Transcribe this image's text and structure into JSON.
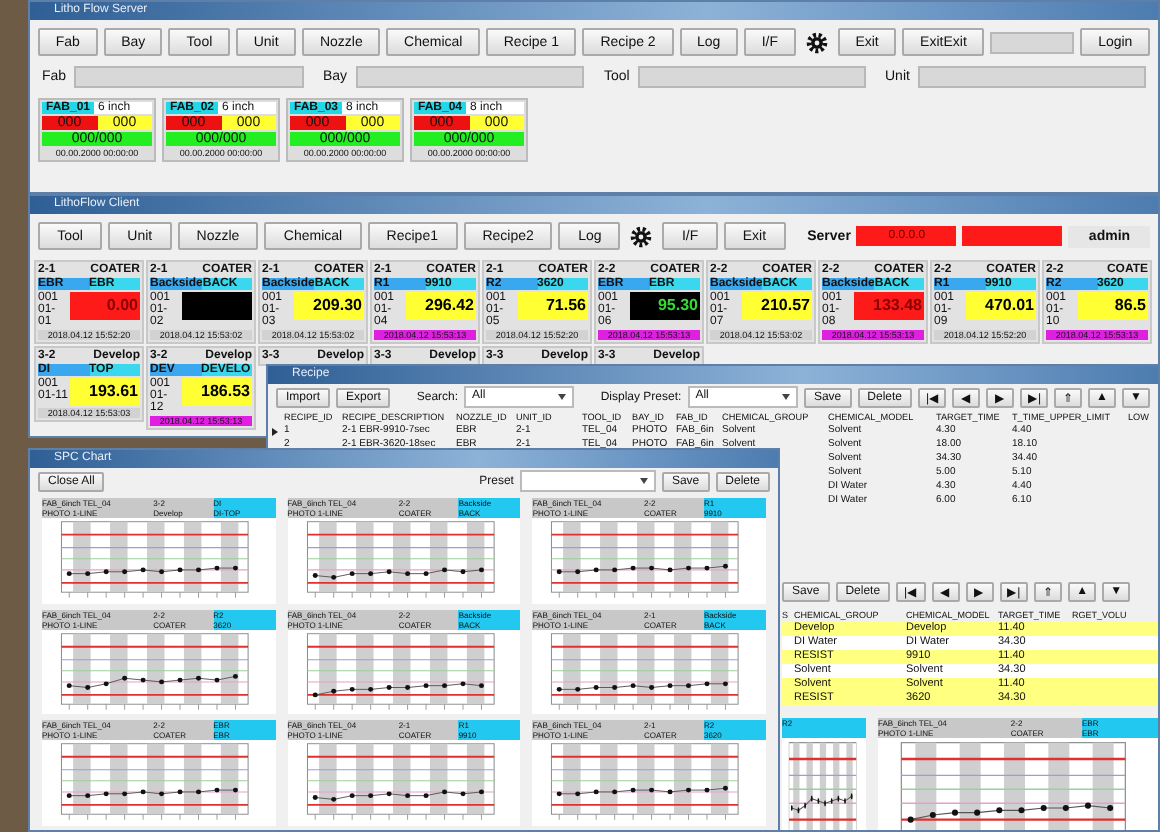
{
  "server_window": {
    "title": "Litho Flow Server",
    "toolbar": [
      {
        "kind": "button",
        "label": "Fab"
      },
      {
        "kind": "button",
        "label": "Bay"
      },
      {
        "kind": "button",
        "label": "Tool"
      },
      {
        "kind": "button",
        "label": "Unit"
      },
      {
        "kind": "button",
        "label": "Nozzle"
      },
      {
        "kind": "button",
        "label": "Chemical"
      },
      {
        "kind": "button",
        "label": "Recipe 1"
      },
      {
        "kind": "button",
        "label": "Recipe 2"
      },
      {
        "kind": "button",
        "label": "Log"
      },
      {
        "kind": "button",
        "label": "I/F"
      },
      {
        "kind": "gear"
      },
      {
        "kind": "button",
        "label": "Exit"
      },
      {
        "kind": "button",
        "label": "ExitExit"
      },
      {
        "kind": "field"
      },
      {
        "kind": "button",
        "label": "Login"
      }
    ],
    "filters": [
      {
        "label": "Fab"
      },
      {
        "label": "Bay"
      },
      {
        "label": "Tool"
      },
      {
        "label": "Unit"
      }
    ],
    "fabs": [
      {
        "name": "FAB_01",
        "size": "6 inch",
        "alarm": "000",
        "warning": "000",
        "count": "000/000",
        "time": "00.00.2000 00:00:00"
      },
      {
        "name": "FAB_02",
        "size": "6 inch",
        "alarm": "000",
        "warning": "000",
        "count": "000/000",
        "time": "00.00.2000 00:00:00"
      },
      {
        "name": "FAB_03",
        "size": "8 inch",
        "alarm": "000",
        "warning": "000",
        "count": "000/000",
        "time": "00.00.2000 00:00:00"
      },
      {
        "name": "FAB_04",
        "size": "8 inch",
        "alarm": "000",
        "warning": "000",
        "count": "000/000",
        "time": "00.00.2000 00:00:00"
      }
    ]
  },
  "client_window": {
    "title": "LithoFlow Client",
    "toolbar": [
      {
        "kind": "button",
        "label": "Tool"
      },
      {
        "kind": "button",
        "label": "Unit"
      },
      {
        "kind": "button",
        "label": "Nozzle"
      },
      {
        "kind": "button",
        "label": "Chemical"
      },
      {
        "kind": "button",
        "label": "Recipe1"
      },
      {
        "kind": "button",
        "label": "Recipe2"
      },
      {
        "kind": "button",
        "label": "Log"
      },
      {
        "kind": "gear"
      },
      {
        "kind": "button",
        "label": "I/F"
      },
      {
        "kind": "button",
        "label": "Exit"
      },
      {
        "kind": "label",
        "label": "Server"
      },
      {
        "kind": "status",
        "value": "0.0.0.0",
        "color": "#ff1a1a"
      },
      {
        "kind": "status",
        "color": "#ff1a1a"
      },
      {
        "kind": "user",
        "label": "admin"
      }
    ],
    "units": [
      {
        "unit": "2-1",
        "type": "COATER",
        "nozzle": "EBR",
        "chemical": "EBR",
        "id": "001",
        "slot": "01-01",
        "value": "0.00",
        "color": "#ff1a1a",
        "time": "2018.04.12 15:52:20",
        "highlight": false
      },
      {
        "unit": "2-1",
        "type": "COATER",
        "nozzle": "Backside",
        "chemical": "BACK",
        "id": "001",
        "slot": "01-02",
        "color": "#000000",
        "time": "2018.04.12 15:53:02",
        "highlight": false
      },
      {
        "unit": "2-1",
        "type": "COATER",
        "nozzle": "Backside",
        "chemical": "BACK",
        "id": "001",
        "slot": "01-03",
        "value": "209.30",
        "color": "#ffff33",
        "time": "2018.04.12 15:53:02",
        "highlight": false
      },
      {
        "unit": "2-1",
        "type": "COATER",
        "nozzle": "R1",
        "chemical": "9910",
        "id": "001",
        "slot": "01-04",
        "value": "296.42",
        "color": "#ffff33",
        "time": "2018.04.12 15:53:13",
        "highlight": true
      },
      {
        "unit": "2-1",
        "type": "COATER",
        "nozzle": "R2",
        "chemical": "3620",
        "id": "001",
        "slot": "01-05",
        "value": "71.56",
        "color": "#ffff33",
        "time": "2018.04.12 15:52:20",
        "highlight": false
      },
      {
        "unit": "2-2",
        "type": "COATER",
        "nozzle": "EBR",
        "chemical": "EBR",
        "id": "001",
        "slot": "01-06",
        "value": "95.30",
        "color": "#000000",
        "time": "2018.04.12 15:53:13",
        "highlight": true
      },
      {
        "unit": "2-2",
        "type": "COATER",
        "nozzle": "Backside",
        "chemical": "BACK",
        "id": "001",
        "slot": "01-07",
        "value": "210.57",
        "color": "#ffff33",
        "time": "2018.04.12 15:53:02",
        "highlight": false
      },
      {
        "unit": "2-2",
        "type": "COATER",
        "nozzle": "Backside",
        "chemical": "BACK",
        "id": "001",
        "slot": "01-08",
        "value": "133.48",
        "color": "#ff1a1a",
        "time": "2018.04.12 15:53:13",
        "highlight": true
      },
      {
        "unit": "2-2",
        "type": "COATER",
        "nozzle": "R1",
        "chemical": "9910",
        "id": "001",
        "slot": "01-09",
        "value": "470.01",
        "color": "#ffff33",
        "time": "2018.04.12 15:52:20",
        "highlight": false
      },
      {
        "unit": "2-2",
        "type": "COATE",
        "nozzle": "R2",
        "chemical": "3620",
        "id": "001",
        "slot": "01-10",
        "value": "86.5",
        "color": "#ffff33",
        "time": "2018.04.12 15:53:13",
        "highlight": true
      },
      {
        "unit": "3-2",
        "type": "Develop",
        "nozzle": "DI",
        "chemical": "TOP",
        "id": "001",
        "slot": "01-11",
        "value": "193.61",
        "color": "#ffff33",
        "time": "2018.04.12 15:53:03",
        "highlight": false
      },
      {
        "unit": "3-2",
        "type": "Develop",
        "nozzle": "DEV",
        "chemical": "DEVELO",
        "id": "001",
        "slot": "01-12",
        "value": "186.53",
        "color": "#ffff33",
        "time": "2018.04.12 15:53:13",
        "highlight": true
      },
      {
        "unit": "3-3",
        "type": "Develop"
      },
      {
        "unit": "3-3",
        "type": "Develop"
      },
      {
        "unit": "3-3",
        "type": "Develop"
      },
      {
        "unit": "3-3",
        "type": "Develop"
      }
    ]
  },
  "recipe_window": {
    "title": "Recipe",
    "toolbar": [
      {
        "kind": "button",
        "label": "Import"
      },
      {
        "kind": "button",
        "label": "Export"
      },
      {
        "kind": "select",
        "label": "Search:",
        "value": "All"
      },
      {
        "kind": "select",
        "label": "Display Preset:",
        "value": "All"
      },
      {
        "kind": "button",
        "label": "Save"
      },
      {
        "kind": "button",
        "label": "Delete"
      },
      {
        "kind": "nav",
        "label": "|◀"
      },
      {
        "kind": "nav",
        "label": "◀"
      },
      {
        "kind": "nav",
        "label": "▶"
      },
      {
        "kind": "nav",
        "label": "▶|"
      },
      {
        "kind": "nav",
        "label": "⇑"
      },
      {
        "kind": "nav",
        "label": "▲"
      },
      {
        "kind": "nav",
        "label": "▼"
      }
    ],
    "table": {
      "columns": [
        "RECIPE_ID",
        "RECIPE_DESCRIPTION",
        "NOZZLE_ID",
        "UNIT_ID",
        "TOOL_ID",
        "BAY_ID",
        "FAB_ID",
        "CHEMICAL_GROUP",
        "CHEMICAL_MODEL",
        "TARGET_TIME",
        "T_TIME_UPPER_LIMIT",
        "LOW"
      ],
      "rows": [
        {
          "selected": true,
          "cells": [
            "1",
            "2-1 EBR-9910-7sec",
            "EBR",
            "2-1",
            "TEL_04",
            "PHOTO",
            "FAB_6in",
            "Solvent",
            "Solvent",
            "4.30",
            "4.40",
            null
          ]
        },
        {
          "selected": false,
          "cells": [
            "2",
            "2-1 EBR-3620-18sec",
            "EBR",
            "2-1",
            "TEL_04",
            "PHOTO",
            "FAB_6in",
            "Solvent",
            "Solvent",
            "18.00",
            "18.10",
            null
          ]
        },
        {
          "selected": false,
          "cells": [
            null,
            null,
            null,
            null,
            null,
            null,
            null,
            null,
            "Solvent",
            "34.30",
            "34.40",
            null
          ]
        },
        {
          "selected": false,
          "cells": [
            null,
            null,
            null,
            null,
            null,
            null,
            null,
            null,
            "Solvent",
            "5.00",
            "5.10",
            null
          ]
        },
        {
          "selected": false,
          "cells": [
            null,
            null,
            null,
            null,
            null,
            null,
            null,
            null,
            "DI Water",
            "4.30",
            "4.40",
            null
          ]
        },
        {
          "selected": false,
          "cells": [
            null,
            null,
            null,
            null,
            null,
            null,
            null,
            null,
            "DI Water",
            "6.00",
            "6.10",
            null
          ]
        }
      ]
    },
    "lower_toolbar": [
      {
        "kind": "button",
        "label": "Save"
      },
      {
        "kind": "button",
        "label": "Delete"
      },
      {
        "kind": "nav",
        "label": "|◀"
      },
      {
        "kind": "nav",
        "label": "◀"
      },
      {
        "kind": "nav",
        "label": "▶"
      },
      {
        "kind": "nav",
        "label": "▶|"
      },
      {
        "kind": "nav",
        "label": "⇑"
      },
      {
        "kind": "nav",
        "label": "▲"
      },
      {
        "kind": "nav",
        "label": "▼"
      }
    ],
    "lower_table": {
      "columns": [
        "S",
        "CHEMICAL_GROUP",
        "CHEMICAL_MODEL",
        "TARGET_TIME",
        "RGET_VOLU"
      ],
      "rows": [
        {
          "highlight": true,
          "cells": [
            null,
            "Develop",
            "Develop",
            "11.40"
          ]
        },
        {
          "highlight": false,
          "cells": [
            null,
            "DI Water",
            "DI Water",
            "34.30"
          ]
        },
        {
          "highlight": true,
          "cells": [
            null,
            "RESIST",
            "9910",
            "11.40"
          ]
        },
        {
          "highlight": false,
          "cells": [
            null,
            "Solvent",
            "Solvent",
            "34.30"
          ]
        },
        {
          "highlight": true,
          "cells": [
            null,
            "Solvent",
            "Solvent",
            "11.40"
          ]
        },
        {
          "highlight": true,
          "cells": [
            null,
            "RESIST",
            "3620",
            "34.30"
          ]
        }
      ]
    },
    "charts": [
      {
        "nozzle": "R2"
      },
      {
        "tool": "FAB_6inch TEL_04",
        "line": "PHOTO 1-LINE",
        "unit": "2-2",
        "type": "COATER",
        "nozzle": "EBR",
        "chemical": "EBR"
      }
    ]
  },
  "chart_window": {
    "title": "SPC Chart",
    "toolbar": [
      {
        "kind": "button",
        "label": "Close All"
      },
      {
        "kind": "select",
        "label": "Preset"
      },
      {
        "kind": "button",
        "label": "Save"
      },
      {
        "kind": "button",
        "label": "Delete"
      }
    ],
    "charts": [
      {
        "tool": "FAB_6inch TEL_04",
        "line": "PHOTO 1-LINE",
        "unit": "3-2",
        "type": "Develop",
        "nozzle": "DI",
        "chemical": "DI-TOP"
      },
      {
        "tool": "FAB_6inch TEL_04",
        "line": "PHOTO 1-LINE",
        "unit": "2-2",
        "type": "COATER",
        "nozzle": "Backside",
        "chemical": "BACK"
      },
      {
        "tool": "FAB_6inch TEL_04",
        "line": "PHOTO 1-LINE",
        "unit": "2-2",
        "type": "COATER",
        "nozzle": "R1",
        "chemical": "9910"
      },
      {
        "tool": "FAB_6inch TEL_04",
        "line": "PHOTO 1-LINE",
        "unit": "2-2",
        "type": "COATER",
        "nozzle": "R2",
        "chemical": "3620"
      },
      {
        "tool": "FAB_6inch TEL_04",
        "line": "PHOTO 1-LINE",
        "unit": "2-2",
        "type": "COATER",
        "nozzle": "Backside",
        "chemical": "BACK"
      },
      {
        "tool": "FAB_6inch TEL_04",
        "line": "PHOTO 1-LINE",
        "unit": "2-1",
        "type": "COATER",
        "nozzle": "Backside",
        "chemical": "BACK"
      },
      {
        "tool": "FAB_6inch TEL_04",
        "line": "PHOTO 1-LINE",
        "unit": "2-2",
        "type": "COATER",
        "nozzle": "EBR",
        "chemical": "EBR"
      },
      {
        "tool": "FAB_6inch TEL_04",
        "line": "PHOTO 1-LINE",
        "unit": "2-1",
        "type": "COATER",
        "nozzle": "R1",
        "chemical": "9910"
      },
      {
        "tool": "FAB_6inch TEL_04",
        "line": "PHOTO 1-LINE",
        "unit": "2-1",
        "type": "COATER",
        "nozzle": "R2",
        "chemical": "3620"
      }
    ]
  }
}
